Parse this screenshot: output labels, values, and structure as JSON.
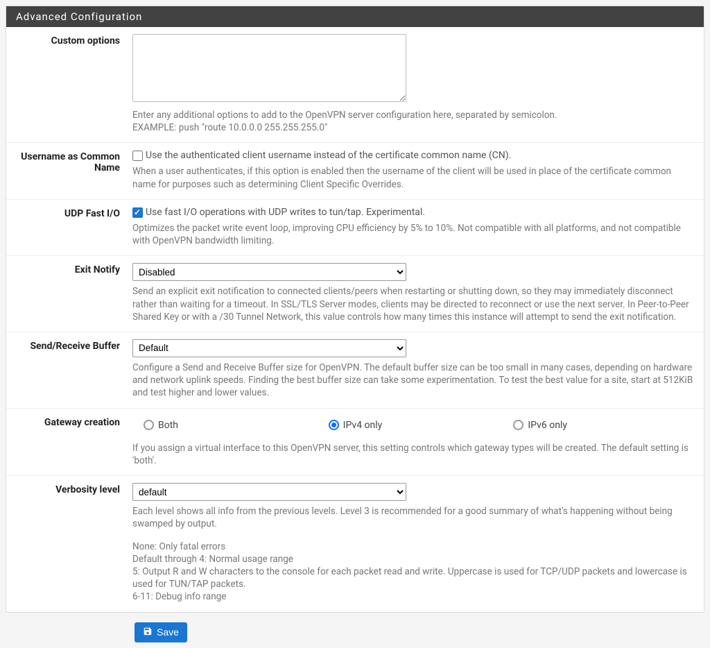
{
  "panel": {
    "title": "Advanced Configuration"
  },
  "custom_options": {
    "label": "Custom options",
    "value": "",
    "help1": "Enter any additional options to add to the OpenVPN server configuration here, separated by semicolon.",
    "help2": "EXAMPLE: push \"route 10.0.0.0 255.255.255.0\""
  },
  "username_cn": {
    "label": "Username as Common Name",
    "checkbox_label": "Use the authenticated client username instead of the certificate common name (CN).",
    "checked": false,
    "help": "When a user authenticates, if this option is enabled then the username of the client will be used in place of the certificate common name for purposes such as determining Client Specific Overrides."
  },
  "udp_fast_io": {
    "label": "UDP Fast I/O",
    "checkbox_label": "Use fast I/O operations with UDP writes to tun/tap. Experimental.",
    "checked": true,
    "help": "Optimizes the packet write event loop, improving CPU efficiency by 5% to 10%. Not compatible with all platforms, and not compatible with OpenVPN bandwidth limiting."
  },
  "exit_notify": {
    "label": "Exit Notify",
    "value": "Disabled",
    "help": "Send an explicit exit notification to connected clients/peers when restarting or shutting down, so they may immediately disconnect rather than waiting for a timeout. In SSL/TLS Server modes, clients may be directed to reconnect or use the next server. In Peer-to-Peer Shared Key or with a /30 Tunnel Network, this value controls how many times this instance will attempt to send the exit notification."
  },
  "send_recv_buffer": {
    "label": "Send/Receive Buffer",
    "value": "Default",
    "help": "Configure a Send and Receive Buffer size for OpenVPN. The default buffer size can be too small in many cases, depending on hardware and network uplink speeds. Finding the best buffer size can take some experimentation. To test the best value for a site, start at 512KiB and test higher and lower values."
  },
  "gateway_creation": {
    "label": "Gateway creation",
    "options": [
      "Both",
      "IPv4 only",
      "IPv6 only"
    ],
    "selected": "IPv4 only",
    "help": "If you assign a virtual interface to this OpenVPN server, this setting controls which gateway types will be created. The default setting is 'both'."
  },
  "verbosity": {
    "label": "Verbosity level",
    "value": "default",
    "help1": "Each level shows all info from the previous levels. Level 3 is recommended for a good summary of what's happening without being swamped by output.",
    "help2": "None: Only fatal errors",
    "help3": "Default through 4: Normal usage range",
    "help4": "5: Output R and W characters to the console for each packet read and write. Uppercase is used for TCP/UDP packets and lowercase is used for TUN/TAP packets.",
    "help5": "6-11: Debug info range"
  },
  "save": {
    "label": "Save"
  }
}
